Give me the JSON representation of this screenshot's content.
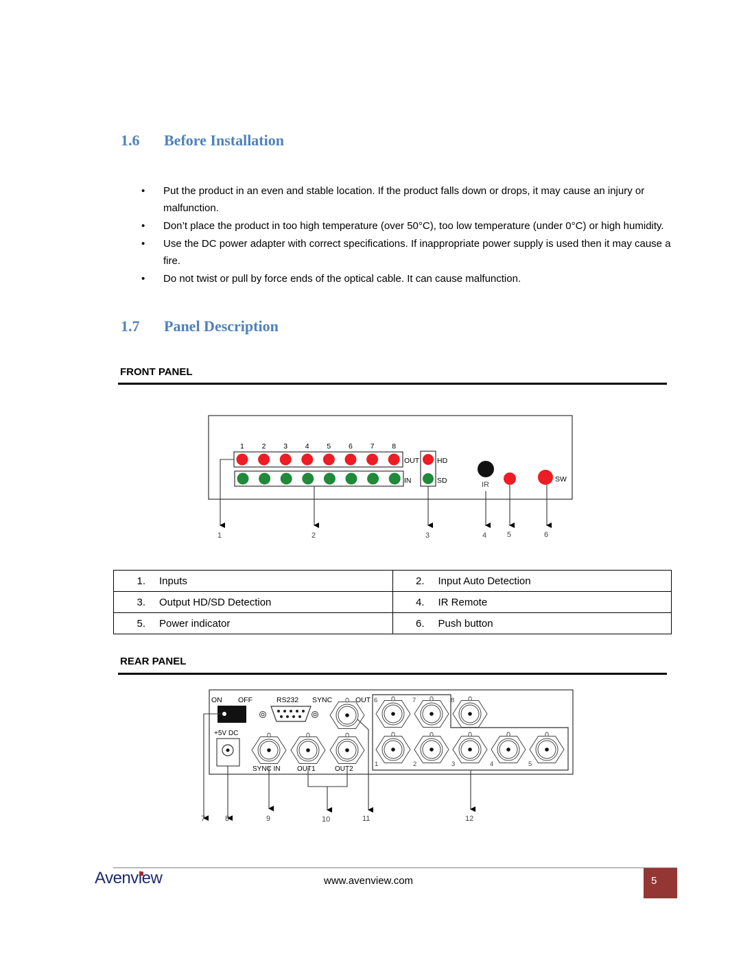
{
  "section_16": {
    "number": "1.6",
    "title": "Before Installation"
  },
  "bullets": [
    "Put the product in an even and stable location. If the product falls down or drops, it may cause an injury or malfunction.",
    "Don’t place the product in too high temperature (over 50°C), too low temperature (under 0°C) or high humidity.",
    "Use the DC power adapter with correct specifications. If inappropriate power supply is used then it may cause a fire.",
    "Do not twist or pull by force ends of the optical cable. It can cause malfunction."
  ],
  "section_17": {
    "number": "1.7",
    "title": "Panel Description"
  },
  "front_panel": {
    "heading": "FRONT PANEL",
    "channel_labels": [
      "1",
      "2",
      "3",
      "4",
      "5",
      "6",
      "7",
      "8"
    ],
    "out_label": "OUT",
    "in_label": "IN",
    "hd_label": "HD",
    "sd_label": "SD",
    "ir_label": "IR",
    "sw_label": "SW",
    "callouts": [
      "1",
      "2",
      "3",
      "4",
      "5",
      "6"
    ],
    "colors": {
      "red_led": "#ee1c24",
      "green_led": "#1f8a3a",
      "ir": "#111111"
    }
  },
  "legend": [
    [
      {
        "num": "1.",
        "text": "Inputs"
      },
      {
        "num": "2.",
        "text": "Input Auto Detection"
      }
    ],
    [
      {
        "num": "3.",
        "text": "Output HD/SD Detection"
      },
      {
        "num": "4.",
        "text": "IR Remote"
      }
    ],
    [
      {
        "num": "5.",
        "text": "Power indicator"
      },
      {
        "num": "6.",
        "text": "Push button"
      }
    ]
  ],
  "rear_panel": {
    "heading": "REAR PANEL",
    "on_label": "ON",
    "off_label": "OFF",
    "rs232_label": "RS232",
    "sync_label": "SYNC",
    "out_label": "OUT",
    "dc_label": "+5V DC",
    "sync_in_label": "SYNC IN",
    "out1_label": "OUT1",
    "out2_label": "OUT2",
    "input_top_labels": [
      "6",
      "7",
      "8"
    ],
    "input_bottom_labels": [
      "1",
      "2",
      "3",
      "4",
      "5"
    ],
    "callouts": [
      "7",
      "8",
      "9",
      "10",
      "11",
      "12"
    ]
  },
  "footer": {
    "logo": "Avenview",
    "url": "www.avenview.com",
    "page": "5",
    "page_color": "#943634"
  }
}
